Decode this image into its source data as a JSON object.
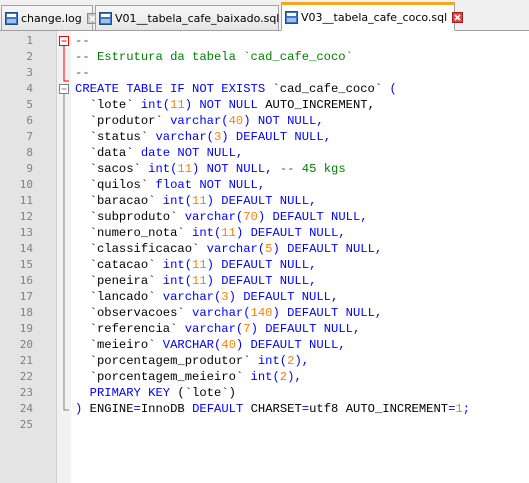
{
  "tabs": [
    {
      "label": "change.log",
      "active": false
    },
    {
      "label": "V01__tabela_cafe_baixado.sql",
      "active": false
    },
    {
      "label": "V03__tabela_cafe_coco.sql",
      "active": true
    }
  ],
  "colors": {
    "keyword": "#0000ff",
    "number": "#ff8000",
    "comment": "#008000",
    "active_tab_accent": "#f5a623"
  },
  "editor": {
    "line_numbers": [
      "1",
      "2",
      "3",
      "4",
      "5",
      "6",
      "7",
      "8",
      "9",
      "10",
      "11",
      "12",
      "13",
      "14",
      "15",
      "16",
      "17",
      "18",
      "19",
      "20",
      "21",
      "22",
      "23",
      "24",
      "25"
    ],
    "lines": [
      [
        {
          "t": "--",
          "c": "cmt"
        }
      ],
      [
        {
          "t": "-- Estrutura da tabela `cad_cafe_coco`",
          "c": "cmt"
        }
      ],
      [
        {
          "t": "--",
          "c": "cmt"
        }
      ],
      [
        {
          "t": "CREATE TABLE IF NOT EXISTS ",
          "c": "kw"
        },
        {
          "t": "`cad_cafe_coco`",
          "c": "txt"
        },
        {
          "t": " (",
          "c": "kw"
        }
      ],
      [
        {
          "t": "  `lote` ",
          "c": "txt"
        },
        {
          "t": "int(",
          "c": "kw"
        },
        {
          "t": "11",
          "c": "num"
        },
        {
          "t": ") NOT NULL ",
          "c": "kw"
        },
        {
          "t": "AUTO_INCREMENT,",
          "c": "txt"
        }
      ],
      [
        {
          "t": "  `produtor` ",
          "c": "txt"
        },
        {
          "t": "varchar(",
          "c": "kw"
        },
        {
          "t": "40",
          "c": "num"
        },
        {
          "t": ") NOT NULL,",
          "c": "kw"
        }
      ],
      [
        {
          "t": "  `status` ",
          "c": "txt"
        },
        {
          "t": "varchar(",
          "c": "kw"
        },
        {
          "t": "3",
          "c": "num"
        },
        {
          "t": ") DEFAULT NULL,",
          "c": "kw"
        }
      ],
      [
        {
          "t": "  `data` ",
          "c": "txt"
        },
        {
          "t": "date NOT NULL,",
          "c": "kw"
        }
      ],
      [
        {
          "t": "  `sacos` ",
          "c": "txt"
        },
        {
          "t": "int(",
          "c": "kw"
        },
        {
          "t": "11",
          "c": "num"
        },
        {
          "t": ") NOT NULL, ",
          "c": "kw"
        },
        {
          "t": "-- 45 kgs",
          "c": "cmt"
        }
      ],
      [
        {
          "t": "  `quilos` ",
          "c": "txt"
        },
        {
          "t": "float NOT NULL,",
          "c": "kw"
        }
      ],
      [
        {
          "t": "  `baracao` ",
          "c": "txt"
        },
        {
          "t": "int(",
          "c": "kw"
        },
        {
          "t": "11",
          "c": "num"
        },
        {
          "t": ") DEFAULT NULL,",
          "c": "kw"
        }
      ],
      [
        {
          "t": "  `subproduto` ",
          "c": "txt"
        },
        {
          "t": "varchar(",
          "c": "kw"
        },
        {
          "t": "70",
          "c": "num"
        },
        {
          "t": ") DEFAULT NULL,",
          "c": "kw"
        }
      ],
      [
        {
          "t": "  `numero_nota` ",
          "c": "txt"
        },
        {
          "t": "int(",
          "c": "kw"
        },
        {
          "t": "11",
          "c": "num"
        },
        {
          "t": ") DEFAULT NULL,",
          "c": "kw"
        }
      ],
      [
        {
          "t": "  `classificacao` ",
          "c": "txt"
        },
        {
          "t": "varchar(",
          "c": "kw"
        },
        {
          "t": "5",
          "c": "num"
        },
        {
          "t": ") DEFAULT NULL,",
          "c": "kw"
        }
      ],
      [
        {
          "t": "  `catacao` ",
          "c": "txt"
        },
        {
          "t": "int(",
          "c": "kw"
        },
        {
          "t": "11",
          "c": "num"
        },
        {
          "t": ") DEFAULT NULL,",
          "c": "kw"
        }
      ],
      [
        {
          "t": "  `peneira` ",
          "c": "txt"
        },
        {
          "t": "int(",
          "c": "kw"
        },
        {
          "t": "11",
          "c": "num"
        },
        {
          "t": ") DEFAULT NULL,",
          "c": "kw"
        }
      ],
      [
        {
          "t": "  `lancado` ",
          "c": "txt"
        },
        {
          "t": "varchar(",
          "c": "kw"
        },
        {
          "t": "3",
          "c": "num"
        },
        {
          "t": ") DEFAULT NULL,",
          "c": "kw"
        }
      ],
      [
        {
          "t": "  `observacoes` ",
          "c": "txt"
        },
        {
          "t": "varchar(",
          "c": "kw"
        },
        {
          "t": "140",
          "c": "num"
        },
        {
          "t": ") DEFAULT NULL,",
          "c": "kw"
        }
      ],
      [
        {
          "t": "  `referencia` ",
          "c": "txt"
        },
        {
          "t": "varchar(",
          "c": "kw"
        },
        {
          "t": "7",
          "c": "num"
        },
        {
          "t": ") DEFAULT NULL,",
          "c": "kw"
        }
      ],
      [
        {
          "t": "  `meieiro` ",
          "c": "txt"
        },
        {
          "t": "VARCHAR(",
          "c": "kw"
        },
        {
          "t": "40",
          "c": "num"
        },
        {
          "t": ") DEFAULT NULL,",
          "c": "kw"
        }
      ],
      [
        {
          "t": "  `porcentagem_produtor` ",
          "c": "txt"
        },
        {
          "t": "int(",
          "c": "kw"
        },
        {
          "t": "2",
          "c": "num"
        },
        {
          "t": "),",
          "c": "kw"
        }
      ],
      [
        {
          "t": "  `porcentagem_meieiro` ",
          "c": "txt"
        },
        {
          "t": "int(",
          "c": "kw"
        },
        {
          "t": "2",
          "c": "num"
        },
        {
          "t": "),",
          "c": "kw"
        }
      ],
      [
        {
          "t": "  PRIMARY KEY ",
          "c": "kw"
        },
        {
          "t": "(`lote`)",
          "c": "txt"
        }
      ],
      [
        {
          "t": ") ",
          "c": "kw"
        },
        {
          "t": "ENGINE",
          "c": "txt"
        },
        {
          "t": "=",
          "c": "kw"
        },
        {
          "t": "InnoDB ",
          "c": "txt"
        },
        {
          "t": "DEFAULT ",
          "c": "kw"
        },
        {
          "t": "CHARSET",
          "c": "txt"
        },
        {
          "t": "=",
          "c": "kw"
        },
        {
          "t": "utf8 ",
          "c": "txt"
        },
        {
          "t": "AUTO_INCREMENT",
          "c": "txt"
        },
        {
          "t": "=",
          "c": "kw"
        },
        {
          "t": "1",
          "c": "num"
        },
        {
          "t": ";",
          "c": "kw"
        }
      ],
      []
    ]
  }
}
